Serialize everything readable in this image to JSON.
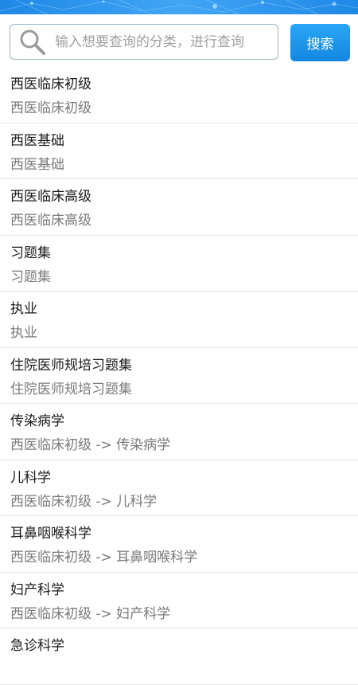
{
  "colors": {
    "header_blue": "#1e88e5",
    "button_blue": "#1a96ea",
    "title_text": "#1a1a1a",
    "path_text": "#7a7a7a",
    "divider": "#e6e6e6"
  },
  "search": {
    "placeholder": "输入想要查询的分类，进行查询",
    "value": "",
    "button_label": "搜索",
    "icon": "search-icon"
  },
  "results": [
    {
      "title": "西医临床初级",
      "path": "西医临床初级"
    },
    {
      "title": "西医基础",
      "path": "西医基础"
    },
    {
      "title": "西医临床高级",
      "path": "西医临床高级"
    },
    {
      "title": "习题集",
      "path": "习题集"
    },
    {
      "title": "执业",
      "path": "执业"
    },
    {
      "title": "住院医师规培习题集",
      "path": "住院医师规培习题集"
    },
    {
      "title": "传染病学",
      "path": "西医临床初级  ->  传染病学"
    },
    {
      "title": "儿科学",
      "path": "西医临床初级  ->  儿科学"
    },
    {
      "title": "耳鼻咽喉科学",
      "path": "西医临床初级  ->  耳鼻咽喉科学"
    },
    {
      "title": "妇产科学",
      "path": "西医临床初级  ->  妇产科学"
    },
    {
      "title": "急诊科学",
      "path": ""
    }
  ]
}
